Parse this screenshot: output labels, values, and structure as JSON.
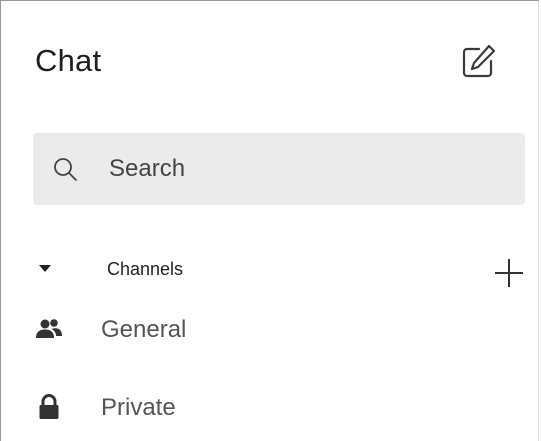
{
  "header": {
    "title": "Chat",
    "compose_icon": "compose-icon"
  },
  "search": {
    "placeholder": "Search",
    "value": "",
    "icon": "search-icon"
  },
  "channels_section": {
    "label": "Channels",
    "expanded": true,
    "add_icon": "plus-icon",
    "items": [
      {
        "label": "General",
        "icon": "group-icon"
      },
      {
        "label": "Private",
        "icon": "lock-icon"
      }
    ]
  },
  "colors": {
    "text_primary": "#1e1e1e",
    "text_secondary": "#555555",
    "search_bg": "#ebebeb",
    "icon": "#333333"
  }
}
